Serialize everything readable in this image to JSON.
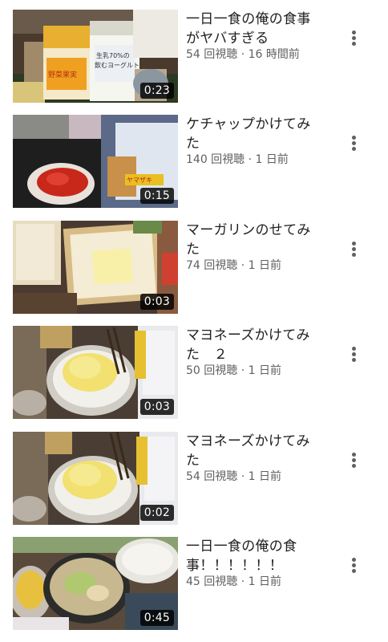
{
  "videos": [
    {
      "title": "一日一食の俺の食事がヤバすぎる",
      "meta": "54 回視聴 · 16 時間前",
      "duration": "0:23",
      "thumb_labels": [
        "野菜果実",
        "生乳70%の",
        "飲むヨーグルト"
      ]
    },
    {
      "title": "ケチャップかけてみた",
      "meta": "140 回視聴 · 1 日前",
      "duration": "0:15",
      "thumb_labels": [
        "ヤマザキ"
      ]
    },
    {
      "title": "マーガリンのせてみた",
      "meta": "74 回視聴 · 1 日前",
      "duration": "0:03",
      "thumb_labels": []
    },
    {
      "title": "マヨネーズかけてみた　２",
      "meta": "50 回視聴 · 1 日前",
      "duration": "0:03",
      "thumb_labels": []
    },
    {
      "title": "マヨネーズかけてみた",
      "meta": "54 回視聴 · 1 日前",
      "duration": "0:02",
      "thumb_labels": []
    },
    {
      "title": "一日一食の俺の食事！！！！！！",
      "meta": "45 回視聴 · 1 日前",
      "duration": "0:45",
      "thumb_labels": []
    }
  ],
  "icons": {
    "more": "more-vert-icon"
  }
}
